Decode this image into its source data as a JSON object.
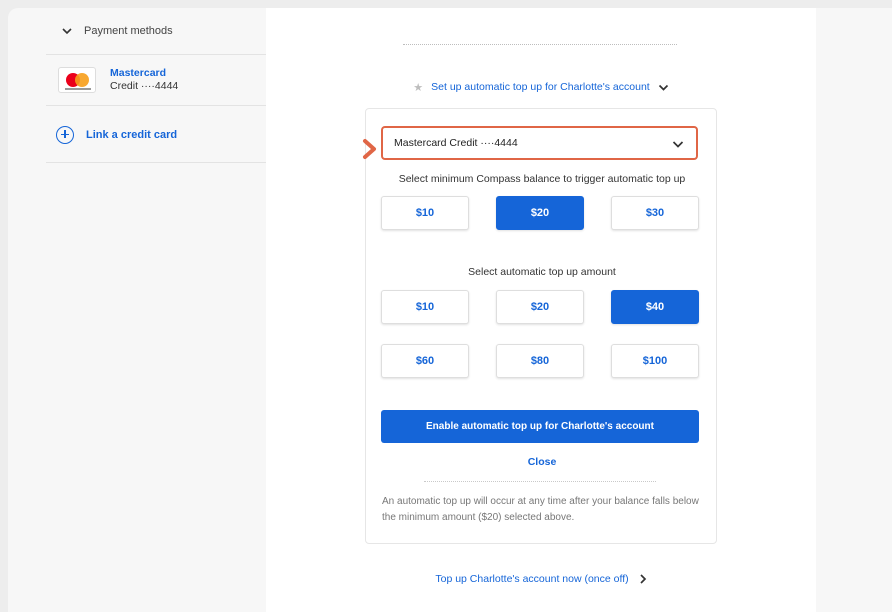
{
  "sidebar": {
    "header": "Payment methods",
    "card": {
      "name": "Mastercard",
      "detail": "Credit ····4444"
    },
    "link_label": "Link a credit card"
  },
  "main": {
    "setup_label": "Set up automatic top up for Charlotte's account",
    "card_select_value": "Mastercard Credit ····4444",
    "min_balance_label": "Select minimum Compass balance to trigger automatic top up",
    "min_balance_options": [
      "$10",
      "$20",
      "$30"
    ],
    "min_balance_selected": "$20",
    "topup_label": "Select automatic top up amount",
    "topup_options": [
      "$10",
      "$20",
      "$40",
      "$60",
      "$80",
      "$100"
    ],
    "topup_selected": "$40",
    "enable_button": "Enable automatic top up for Charlotte's account",
    "close_link": "Close",
    "note": "An automatic top up will occur at any time after your balance falls below the minimum amount ($20) selected above.",
    "bottom_link": "Top up Charlotte's account now (once off)"
  },
  "colors": {
    "accent": "#1565d8",
    "highlight": "#e06646"
  }
}
